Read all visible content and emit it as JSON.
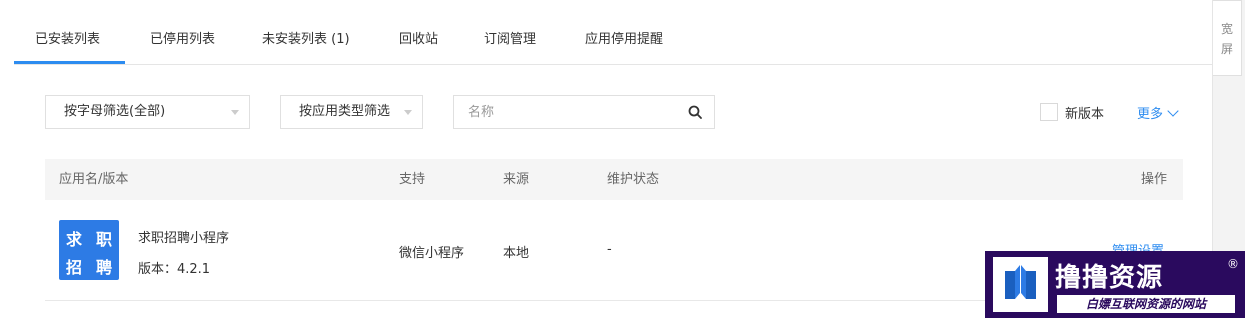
{
  "tabs": [
    {
      "label": "已安装列表",
      "active": true
    },
    {
      "label": "已停用列表"
    },
    {
      "label": "未安装列表",
      "count": "(1)"
    },
    {
      "label": "回收站"
    },
    {
      "label": "订阅管理"
    },
    {
      "label": "应用停用提醒"
    }
  ],
  "filters": {
    "letter_filter": "按字母筛选(全部)",
    "type_filter": "按应用类型筛选",
    "search_placeholder": "名称",
    "new_version_label": "新版本",
    "more_label": "更多"
  },
  "wide_button": [
    "宽",
    "屏"
  ],
  "table": {
    "headers": {
      "name": "应用名/版本",
      "support": "支持",
      "source": "来源",
      "status": "维护状态",
      "actions": "操作"
    },
    "rows": [
      {
        "icon_text": [
          "求",
          "职",
          "招",
          "聘"
        ],
        "name": "求职招聘小程序",
        "version": "版本：4.2.1",
        "support": "微信小程序",
        "source": "本地",
        "status": "-",
        "action": "管理设置"
      }
    ]
  },
  "colors": {
    "accent": "#2d8cf0",
    "app_icon_bg": "#2d7be5",
    "watermark_bg": "#2a0a5e"
  },
  "watermark": {
    "title": "撸撸资源",
    "registered": "®",
    "subtitle": "白嫖互联网资源的网站"
  }
}
